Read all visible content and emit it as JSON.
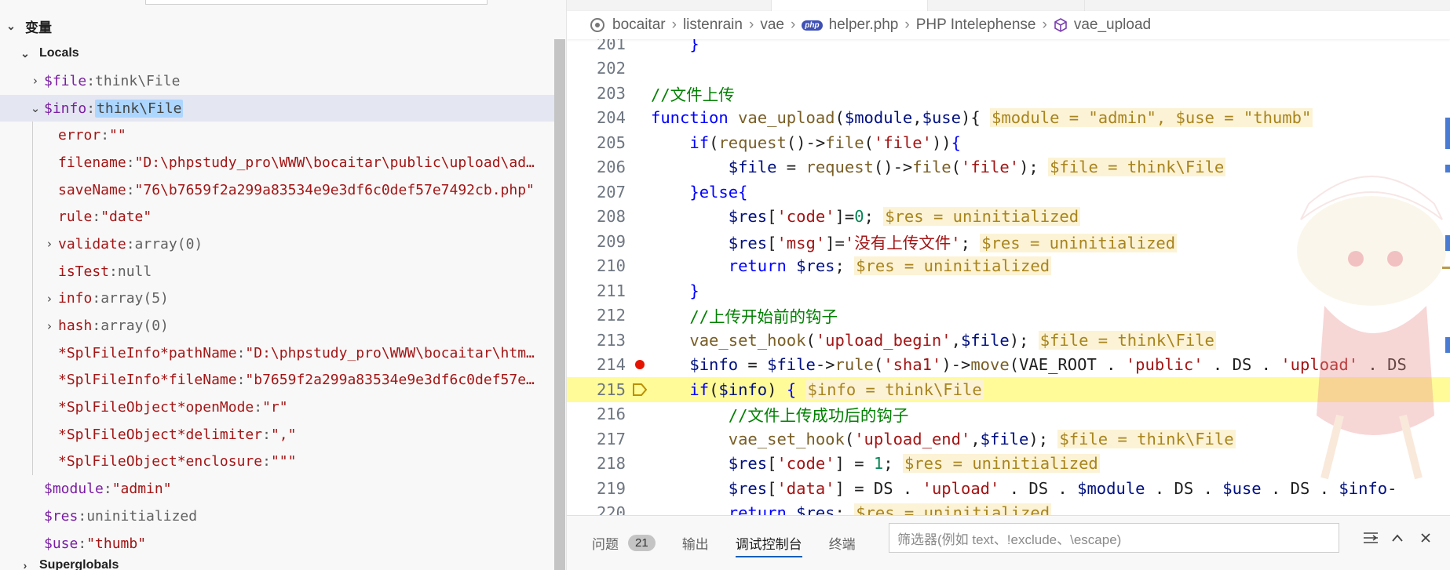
{
  "debug": {
    "section_title": "变量",
    "locals_label": "Locals",
    "superglobals_label": "Superglobals",
    "vars": [
      {
        "name": "$file",
        "value": "think\\File",
        "kind": "type",
        "tw": "›",
        "indent": 1
      },
      {
        "name": "$info",
        "value": "think\\File",
        "kind": "highlight",
        "tw": "⌄",
        "indent": 1,
        "selected": true
      },
      {
        "name": "error",
        "value": "\"\"",
        "kind": "str",
        "tw": "",
        "indent": 2
      },
      {
        "name": "filename",
        "value": "\"D:\\phpstudy_pro\\WWW\\bocaitar\\public\\upload\\ad…",
        "kind": "str",
        "tw": "",
        "indent": 2
      },
      {
        "name": "saveName",
        "value": "\"76\\b7659f2a299a83534e9e3df6c0def57e7492cb.php\"",
        "kind": "str",
        "tw": "",
        "indent": 2
      },
      {
        "name": "rule",
        "value": "\"date\"",
        "kind": "str",
        "tw": "",
        "indent": 2
      },
      {
        "name": "validate",
        "value": "array(0)",
        "kind": "type",
        "tw": "›",
        "indent": 2
      },
      {
        "name": "isTest",
        "value": "null",
        "kind": "type",
        "tw": "",
        "indent": 2
      },
      {
        "name": "info",
        "value": "array(5)",
        "kind": "type",
        "tw": "›",
        "indent": 2
      },
      {
        "name": "hash",
        "value": "array(0)",
        "kind": "type",
        "tw": "›",
        "indent": 2
      },
      {
        "name": "*SplFileInfo*pathName",
        "value": "\"D:\\phpstudy_pro\\WWW\\bocaitar\\htm…",
        "kind": "str",
        "tw": "",
        "indent": 2
      },
      {
        "name": "*SplFileInfo*fileName",
        "value": "\"b7659f2a299a83534e9e3df6c0def57e…",
        "kind": "str",
        "tw": "",
        "indent": 2
      },
      {
        "name": "*SplFileObject*openMode",
        "value": "\"r\"",
        "kind": "str",
        "tw": "",
        "indent": 2
      },
      {
        "name": "*SplFileObject*delimiter",
        "value": "\",\"",
        "kind": "str",
        "tw": "",
        "indent": 2
      },
      {
        "name": "*SplFileObject*enclosure",
        "value": "\"\"\"",
        "kind": "str",
        "tw": "",
        "indent": 2
      },
      {
        "name": "$module",
        "value": "\"admin\"",
        "kind": "str",
        "tw": "",
        "indent": 1
      },
      {
        "name": "$res",
        "value": "uninitialized",
        "kind": "type",
        "tw": "",
        "indent": 1
      },
      {
        "name": "$use",
        "value": "\"thumb\"",
        "kind": "str",
        "tw": "",
        "indent": 1
      }
    ]
  },
  "breadcrumb": {
    "items": [
      "bocaitar",
      "listenrain",
      "vae",
      "helper.php",
      "PHP Intelephense",
      "vae_upload"
    ],
    "php_badge": "php"
  },
  "code": {
    "lines": [
      {
        "n": "201",
        "tokens": [
          [
            "pl",
            "    "
          ],
          [
            "kw",
            "}"
          ]
        ]
      },
      {
        "n": "202",
        "tokens": []
      },
      {
        "n": "203",
        "tokens": [
          [
            "cmt",
            "//文件上传"
          ]
        ]
      },
      {
        "n": "204",
        "tokens": [
          [
            "kw",
            "function "
          ],
          [
            "fn",
            "vae_upload"
          ],
          [
            "pl",
            "("
          ],
          [
            "var",
            "$module"
          ],
          [
            "pl",
            ","
          ],
          [
            "var",
            "$use"
          ],
          [
            "pl",
            "){ "
          ],
          [
            "inl",
            "$module = \"admin\", $use = \"thumb\""
          ]
        ]
      },
      {
        "n": "205",
        "tokens": [
          [
            "pl",
            "    "
          ],
          [
            "kw",
            "if"
          ],
          [
            "pl",
            "("
          ],
          [
            "fn",
            "request"
          ],
          [
            "pl",
            "()->"
          ],
          [
            "fn",
            "file"
          ],
          [
            "pl",
            "("
          ],
          [
            "str",
            "'file'"
          ],
          [
            "pl",
            "))"
          ],
          [
            "kw",
            "{"
          ]
        ]
      },
      {
        "n": "206",
        "tokens": [
          [
            "pl",
            "        "
          ],
          [
            "var",
            "$file"
          ],
          [
            "pl",
            " = "
          ],
          [
            "fn",
            "request"
          ],
          [
            "pl",
            "()->"
          ],
          [
            "fn",
            "file"
          ],
          [
            "pl",
            "("
          ],
          [
            "str",
            "'file'"
          ],
          [
            "pl",
            "); "
          ],
          [
            "inl",
            "$file = think\\File"
          ]
        ]
      },
      {
        "n": "207",
        "tokens": [
          [
            "pl",
            "    "
          ],
          [
            "kw",
            "}"
          ],
          [
            "kw",
            "else"
          ],
          [
            "kw",
            "{"
          ]
        ]
      },
      {
        "n": "208",
        "tokens": [
          [
            "pl",
            "        "
          ],
          [
            "var",
            "$res"
          ],
          [
            "pl",
            "["
          ],
          [
            "str",
            "'code'"
          ],
          [
            "pl",
            "]="
          ],
          [
            "num",
            "0"
          ],
          [
            "pl",
            "; "
          ],
          [
            "inl",
            "$res = uninitialized"
          ]
        ]
      },
      {
        "n": "209",
        "tokens": [
          [
            "pl",
            "        "
          ],
          [
            "var",
            "$res"
          ],
          [
            "pl",
            "["
          ],
          [
            "str",
            "'msg'"
          ],
          [
            "pl",
            "]="
          ],
          [
            "str",
            "'没有上传文件'"
          ],
          [
            "pl",
            "; "
          ],
          [
            "inl",
            "$res = uninitialized"
          ]
        ]
      },
      {
        "n": "210",
        "tokens": [
          [
            "pl",
            "        "
          ],
          [
            "kw",
            "return "
          ],
          [
            "var",
            "$res"
          ],
          [
            "pl",
            "; "
          ],
          [
            "inl",
            "$res = uninitialized"
          ]
        ]
      },
      {
        "n": "211",
        "tokens": [
          [
            "pl",
            "    "
          ],
          [
            "kw",
            "}"
          ]
        ]
      },
      {
        "n": "212",
        "tokens": [
          [
            "pl",
            "    "
          ],
          [
            "cmt",
            "//上传开始前的钩子"
          ]
        ]
      },
      {
        "n": "213",
        "tokens": [
          [
            "pl",
            "    "
          ],
          [
            "fn",
            "vae_set_hook"
          ],
          [
            "pl",
            "("
          ],
          [
            "str",
            "'upload_begin'"
          ],
          [
            "pl",
            ","
          ],
          [
            "var",
            "$file"
          ],
          [
            "pl",
            "); "
          ],
          [
            "inl",
            "$file = think\\File"
          ]
        ]
      },
      {
        "n": "214",
        "marker": "breakpoint",
        "tokens": [
          [
            "pl",
            "    "
          ],
          [
            "var",
            "$info"
          ],
          [
            "pl",
            " = "
          ],
          [
            "var",
            "$file"
          ],
          [
            "pl",
            "->"
          ],
          [
            "fn",
            "rule"
          ],
          [
            "pl",
            "("
          ],
          [
            "str",
            "'sha1'"
          ],
          [
            "pl",
            ")->"
          ],
          [
            "fn",
            "move"
          ],
          [
            "pl",
            "(VAE_ROOT . "
          ],
          [
            "str",
            "'public'"
          ],
          [
            "pl",
            " . DS . "
          ],
          [
            "str",
            "'upload'"
          ],
          [
            "pl",
            " . DS"
          ]
        ]
      },
      {
        "n": "215",
        "marker": "current",
        "tokens": [
          [
            "pl",
            "    "
          ],
          [
            "kw",
            "if"
          ],
          [
            "pl",
            "("
          ],
          [
            "var",
            "$info"
          ],
          [
            "pl",
            ") "
          ],
          [
            "kw",
            "{"
          ],
          [
            "pl",
            " "
          ],
          [
            "inl",
            "$info = think\\File"
          ]
        ]
      },
      {
        "n": "216",
        "tokens": [
          [
            "pl",
            "        "
          ],
          [
            "cmt",
            "//文件上传成功后的钩子"
          ]
        ]
      },
      {
        "n": "217",
        "tokens": [
          [
            "pl",
            "        "
          ],
          [
            "fn",
            "vae_set_hook"
          ],
          [
            "pl",
            "("
          ],
          [
            "str",
            "'upload_end'"
          ],
          [
            "pl",
            ","
          ],
          [
            "var",
            "$file"
          ],
          [
            "pl",
            "); "
          ],
          [
            "inl",
            "$file = think\\File"
          ]
        ]
      },
      {
        "n": "218",
        "tokens": [
          [
            "pl",
            "        "
          ],
          [
            "var",
            "$res"
          ],
          [
            "pl",
            "["
          ],
          [
            "str",
            "'code'"
          ],
          [
            "pl",
            "] = "
          ],
          [
            "num",
            "1"
          ],
          [
            "pl",
            "; "
          ],
          [
            "inl",
            "$res = uninitialized"
          ]
        ]
      },
      {
        "n": "219",
        "tokens": [
          [
            "pl",
            "        "
          ],
          [
            "var",
            "$res"
          ],
          [
            "pl",
            "["
          ],
          [
            "str",
            "'data'"
          ],
          [
            "pl",
            "] = DS . "
          ],
          [
            "str",
            "'upload'"
          ],
          [
            "pl",
            " . DS . "
          ],
          [
            "var",
            "$module"
          ],
          [
            "pl",
            " . DS . "
          ],
          [
            "var",
            "$use"
          ],
          [
            "pl",
            " . DS . "
          ],
          [
            "var",
            "$info"
          ],
          [
            "pl",
            "-"
          ]
        ]
      },
      {
        "n": "220",
        "tokens": [
          [
            "pl",
            "        "
          ],
          [
            "kw",
            "return "
          ],
          [
            "var",
            "$res"
          ],
          [
            "pl",
            "; "
          ],
          [
            "inl",
            "$res = uninitialized"
          ]
        ]
      }
    ]
  },
  "panel": {
    "tabs": [
      {
        "label": "问题",
        "badge": "21",
        "active": false
      },
      {
        "label": "输出",
        "active": false
      },
      {
        "label": "调试控制台",
        "active": true
      },
      {
        "label": "终端",
        "active": false
      }
    ],
    "filter_placeholder": "筛选器(例如 text、!exclude、\\escape)"
  },
  "colors": {
    "accent": "#005fb8",
    "breakpoint": "#e51400",
    "current_line": "#fffb99",
    "inline_value_bg": "#fcf3d6"
  }
}
